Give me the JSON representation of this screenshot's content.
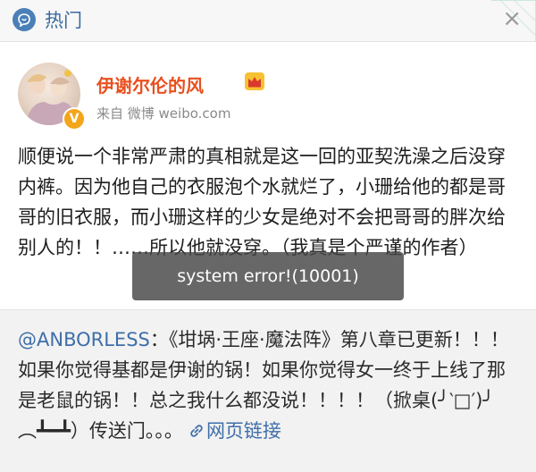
{
  "header": {
    "title": "热门",
    "close_glyph": "×",
    "icons": {
      "hot": "hot-chat-icon",
      "close": "close-icon",
      "corner": "corner-decoration-icon"
    }
  },
  "post": {
    "username": "伊谢尔伦的风",
    "source": "来自 微博 weibo.com",
    "text": "顺便说一个非常严肃的真相就是这一回的亚契洗澡之后没穿内裤。因为他自己的衣服泡个水就烂了，小珊给他的都是哥哥的旧衣服，而小珊这样的少女是绝对不会把哥哥的胖次给别人的！！……所以他就没穿。（我真是个严谨的作者）",
    "icons": {
      "avatar": "avatar",
      "verified": "verified-badge-icon",
      "crown": "crown-icon"
    }
  },
  "repost": {
    "mention": "@ANBORLESS",
    "text": "：《坩埚·王座·魔法阵》第八章已更新！！！如果你觉得基都是伊谢的锅！如果你觉得女一终于上线了那是老鼠的锅！！总之我什么都没说！！！！（掀桌(╯‵□′)╯︵┻━┻）传送门。。。",
    "link_label": "网页链接",
    "icons": {
      "link": "link-icon"
    }
  },
  "toast": {
    "message": "system error!(10001)"
  },
  "colors": {
    "accent_blue": "#3f6ea8",
    "username_orange": "#e8501e",
    "repost_bg": "#f2f2f2",
    "verified_gold": "#f3a51b"
  }
}
